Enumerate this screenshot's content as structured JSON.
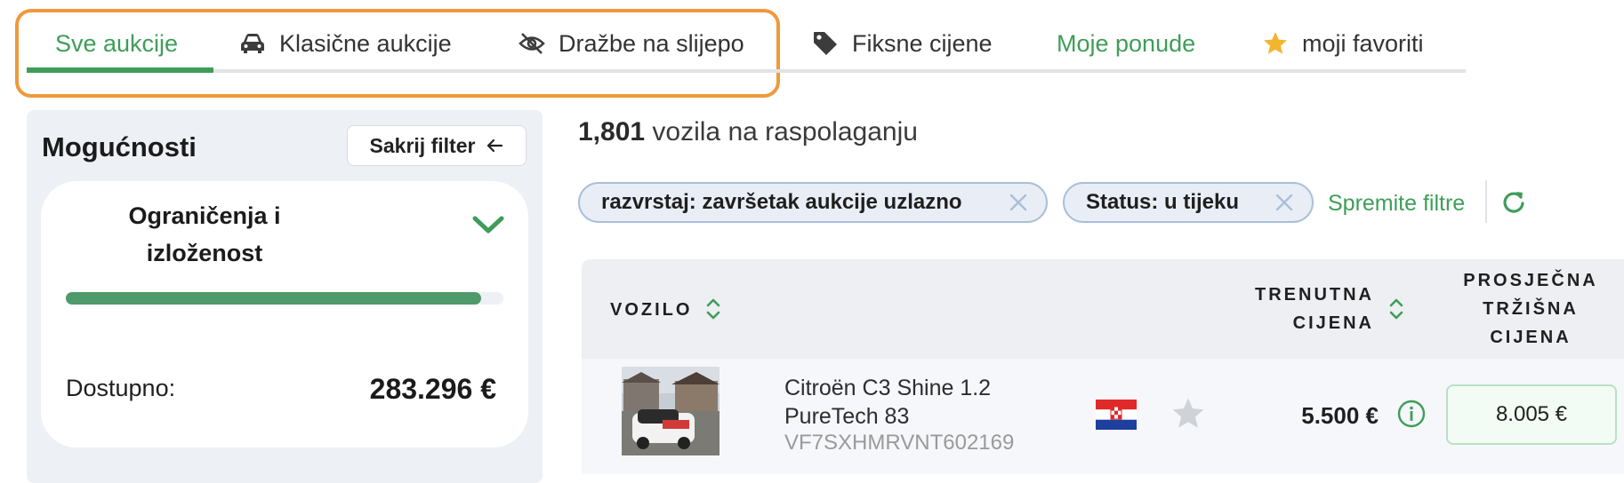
{
  "tabs": [
    {
      "label": "Sve aukcije",
      "icon": "none",
      "active": true
    },
    {
      "label": "Klasične aukcije",
      "icon": "car-icon"
    },
    {
      "label": "Dražbe na slijepo",
      "icon": "eye-slash-icon"
    },
    {
      "label": "Fiksne cijene",
      "icon": "tag-icon"
    },
    {
      "label": "Moje ponude",
      "icon": "none"
    },
    {
      "label": "moji favoriti",
      "icon": "star-icon"
    }
  ],
  "sidebar": {
    "title": "Mogućnosti",
    "hide_filter": "Sakrij filter",
    "limits_card": {
      "title_line1": "Ograničenja i",
      "title_line2": "izloženost",
      "progress": 0.95,
      "available_label": "Dostupno:",
      "available_value": "283.296 €"
    }
  },
  "results": {
    "count": "1,801",
    "count_suffix": " vozila na raspolaganju"
  },
  "filters": {
    "chips": [
      {
        "label": "razvrstaj: završetak aukcije uzlazno"
      },
      {
        "label": "Status: u tijeku"
      }
    ],
    "save_label": "Spremite filtre"
  },
  "table": {
    "headers": {
      "vehicle": "VOZILO",
      "current_price_line1": "TRENUTNA",
      "current_price_line2": "CIJENA",
      "avg_price_line1": "PROSJEČNA",
      "avg_price_line2": "TRŽIŠNA",
      "avg_price_line3": "CIJENA"
    },
    "rows": [
      {
        "name_line1": "Citroën C3 Shine 1.2",
        "name_line2": "PureTech 83",
        "vin": "VF7SXHMRVNT602169",
        "country_flag": "croatia-flag",
        "current_price": "5.500 €",
        "avg_market_price": "8.005 €"
      }
    ]
  },
  "colors": {
    "accent_green": "#3f9d59",
    "highlight_orange": "#ee9a3a",
    "sidebar_bg": "#edf0f5",
    "chip_bg": "#e9eef6"
  }
}
